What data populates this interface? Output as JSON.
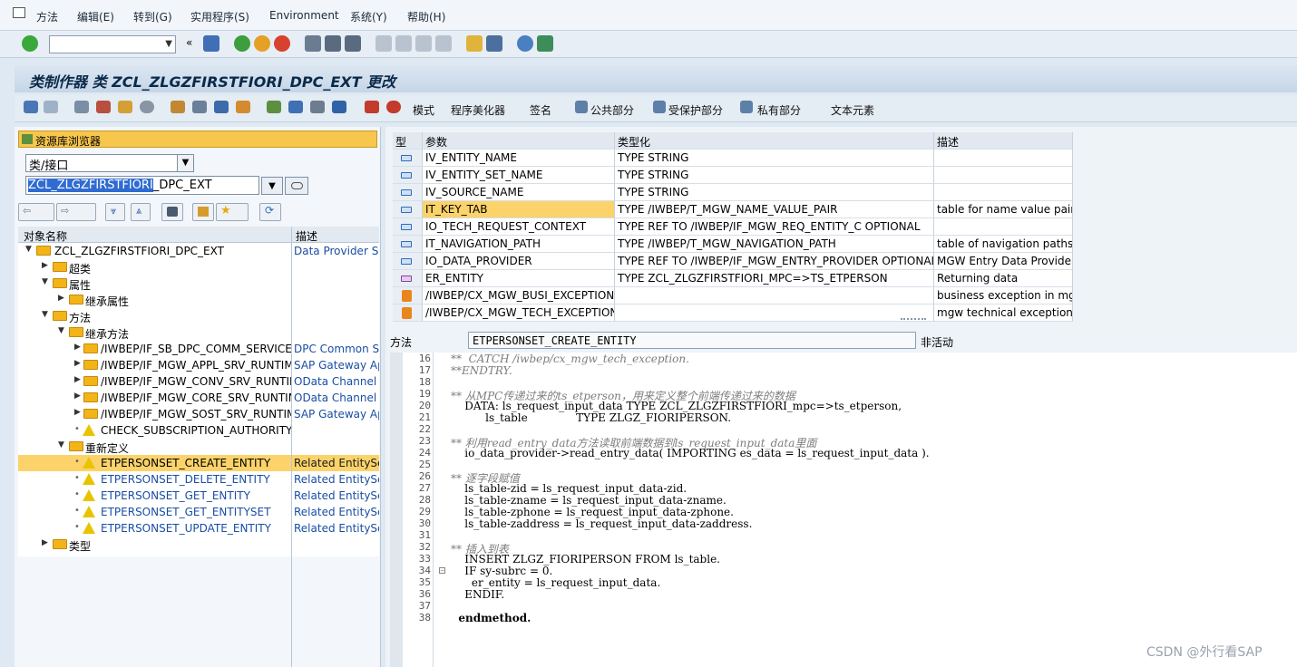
{
  "menu": [
    "方法",
    "编辑(E)",
    "转到(G)",
    "实用程序(S)",
    "Environment",
    "系统(Y)",
    "帮助(H)"
  ],
  "window": {
    "title": "类制作器 类 ZCL_ZLGZFIRSTFIORI_DPC_EXT 更改"
  },
  "app_toolbar": {
    "mode": "模式",
    "pretty_printer": "程序美化器",
    "signature": "签名",
    "public_section": "公共部分",
    "protected_section": "受保护部分",
    "private_section": "私有部分",
    "text_elements": "文本元素"
  },
  "left": {
    "repo_browser": "资源库浏览器",
    "object_type": "类/接口",
    "class_input_selected": "ZCL_ZLGZFIRSTFIORI",
    "class_input_rest": "_DPC_EXT",
    "col_name": "对象名称",
    "col_desc": "描述",
    "tree": [
      {
        "name": "ZCL_ZLGZFIRSTFIORI_DPC_EXT",
        "desc": "Data Provider Sec"
      },
      {
        "name": "超类",
        "desc": ""
      },
      {
        "name": "属性",
        "desc": ""
      },
      {
        "name": "继承属性",
        "desc": ""
      },
      {
        "name": "方法",
        "desc": ""
      },
      {
        "name": "继承方法",
        "desc": ""
      },
      {
        "name": "/IWBEP/IF_SB_DPC_COMM_SERVICES",
        "desc": "DPC Common Ser"
      },
      {
        "name": "/IWBEP/IF_MGW_APPL_SRV_RUNTIME",
        "desc": "SAP Gateway Ap"
      },
      {
        "name": "/IWBEP/IF_MGW_CONV_SRV_RUNTIME",
        "desc": "OData Channel -"
      },
      {
        "name": "/IWBEP/IF_MGW_CORE_SRV_RUNTIME",
        "desc": "OData Channel -"
      },
      {
        "name": "/IWBEP/IF_MGW_SOST_SRV_RUNTIME",
        "desc": "SAP Gateway Ap"
      },
      {
        "name": "CHECK_SUBSCRIPTION_AUTHORITY",
        "desc": ""
      },
      {
        "name": "重新定义",
        "desc": ""
      },
      {
        "name": "ETPERSONSET_CREATE_ENTITY",
        "desc": "Related EntitySet"
      },
      {
        "name": "ETPERSONSET_DELETE_ENTITY",
        "desc": "Related EntitySet"
      },
      {
        "name": "ETPERSONSET_GET_ENTITY",
        "desc": "Related EntitySet"
      },
      {
        "name": "ETPERSONSET_GET_ENTITYSET",
        "desc": "Related EntitySet"
      },
      {
        "name": "ETPERSONSET_UPDATE_ENTITY",
        "desc": "Related EntitySet"
      },
      {
        "name": "类型",
        "desc": ""
      }
    ]
  },
  "params": {
    "headers": [
      "型",
      "参数",
      "类型化",
      "描述"
    ],
    "rows": [
      {
        "name": "IV_ENTITY_NAME",
        "type": "TYPE STRING",
        "desc": ""
      },
      {
        "name": "IV_ENTITY_SET_NAME",
        "type": "TYPE STRING",
        "desc": ""
      },
      {
        "name": "IV_SOURCE_NAME",
        "type": "TYPE STRING",
        "desc": ""
      },
      {
        "name": "IT_KEY_TAB",
        "type": "TYPE /IWBEP/T_MGW_NAME_VALUE_PAIR",
        "desc": "table for name value pairs"
      },
      {
        "name": "IO_TECH_REQUEST_CONTEXT",
        "type": "TYPE REF TO /IWBEP/IF_MGW_REQ_ENTITY_C OPTIONAL",
        "desc": ""
      },
      {
        "name": "IT_NAVIGATION_PATH",
        "type": "TYPE /IWBEP/T_MGW_NAVIGATION_PATH",
        "desc": "table of navigation paths"
      },
      {
        "name": "IO_DATA_PROVIDER",
        "type": "TYPE REF TO /IWBEP/IF_MGW_ENTRY_PROVIDER OPTIONAL",
        "desc": "MGW Entry Data Provider"
      },
      {
        "name": "ER_ENTITY",
        "type": "TYPE ZCL_ZLGZFIRSTFIORI_MPC=>TS_ETPERSON",
        "desc": "Returning data"
      },
      {
        "name": "/IWBEP/CX_MGW_BUSI_EXCEPTION",
        "type": "",
        "desc": "business exception in mgw"
      },
      {
        "name": "/IWBEP/CX_MGW_TECH_EXCEPTION",
        "type": "",
        "desc": "mgw technical exception"
      }
    ]
  },
  "method": {
    "label": "方法",
    "value": "ETPERSONSET_CREATE_ENTITY",
    "status": "非活动"
  },
  "code": {
    "line_numbers": [
      "16",
      "17",
      "18",
      "19",
      "20",
      "21",
      "22",
      "23",
      "24",
      "25",
      "26",
      "27",
      "28",
      "29",
      "30",
      "31",
      "32",
      "33",
      "34",
      "35",
      "36",
      "37",
      "38"
    ],
    "lines": [
      "**  CATCH /iwbep/cx_mgw_tech_exception.",
      "**ENDTRY.",
      "",
      "** 从MPC传递过来的ts_etperson，用来定义整个前端传递过来的数据",
      "    DATA: ls_request_input_data TYPE ZCL_ZLGZFIRSTFIORI_mpc=>ts_etperson,",
      "          ls_table              TYPE ZLGZ_FIORIPERSON.",
      "",
      "** 利用read_entry_data方法读取前端数据到ls_request_input_data里面",
      "    io_data_provider->read_entry_data( IMPORTING es_data = ls_request_input_data ).",
      "",
      "** 逐字段赋值",
      "    ls_table-zid = ls_request_input_data-zid.",
      "    ls_table-zname = ls_request_input_data-zname.",
      "    ls_table-zphone = ls_request_input_data-zphone.",
      "    ls_table-zaddress = ls_request_input_data-zaddress.",
      "",
      "** 插入到表",
      "    INSERT ZLGZ_FIORIPERSON FROM ls_table.",
      "    IF sy-subrc = 0.",
      "      er_entity = ls_request_input_data.",
      "    ENDIF.",
      "",
      "  endmethod."
    ]
  },
  "watermark": "CSDN @外行看SAP",
  "colors": {
    "highlight": "#fbd36a",
    "link": "#1a4ea3",
    "keyword": "#0000cc"
  }
}
